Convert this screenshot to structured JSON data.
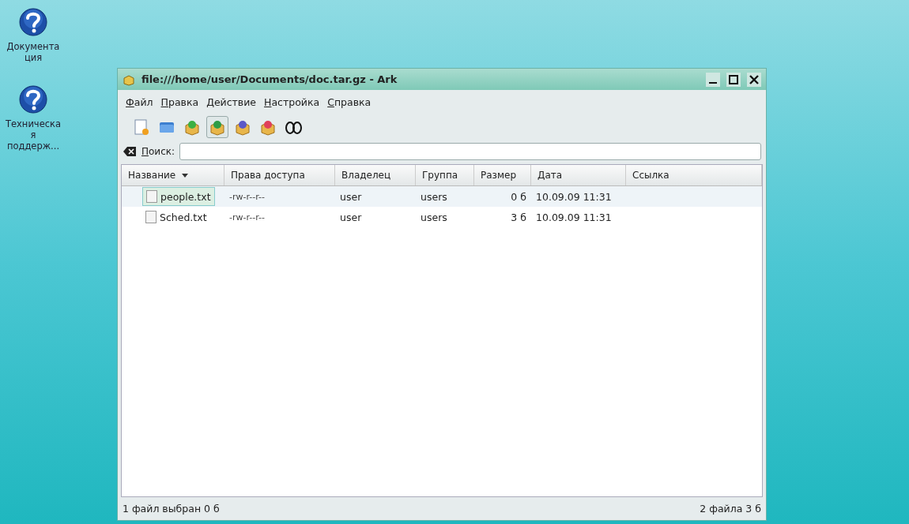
{
  "desktop_icons": [
    {
      "label": "Документа ция"
    },
    {
      "label": "Техническа я поддерж..."
    }
  ],
  "window": {
    "title": "file:///home/user/Documents/doc.tar.gz - Ark"
  },
  "menu": [
    "Файл",
    "Правка",
    "Действие",
    "Настройка",
    "Справка"
  ],
  "toolbar": [
    {
      "kind": "new",
      "pressed": false
    },
    {
      "kind": "open",
      "pressed": false
    },
    {
      "kind": "add",
      "pressed": false
    },
    {
      "kind": "extract",
      "pressed": true
    },
    {
      "kind": "view",
      "pressed": false
    },
    {
      "kind": "delete",
      "pressed": false
    },
    {
      "kind": "glasses",
      "pressed": false
    }
  ],
  "search": {
    "label": "Поиск:"
  },
  "table": {
    "columns": [
      "Название",
      "Права доступа",
      "Владелец",
      "Группа",
      "Размер",
      "Дата",
      "Ссылка"
    ],
    "rows": [
      {
        "selected": true,
        "cells": [
          "people.txt",
          "-rw-r--r--",
          "user",
          "users",
          "0 б",
          "10.09.09 11:31",
          null
        ]
      },
      {
        "selected": false,
        "cells": [
          "Sched.txt",
          "-rw-r--r--",
          "user",
          "users",
          "3 б",
          "10.09.09 11:31",
          null
        ]
      }
    ]
  },
  "status_bar": {
    "left": "1 файл выбран  0 б",
    "right": "2 файла 3 б"
  }
}
